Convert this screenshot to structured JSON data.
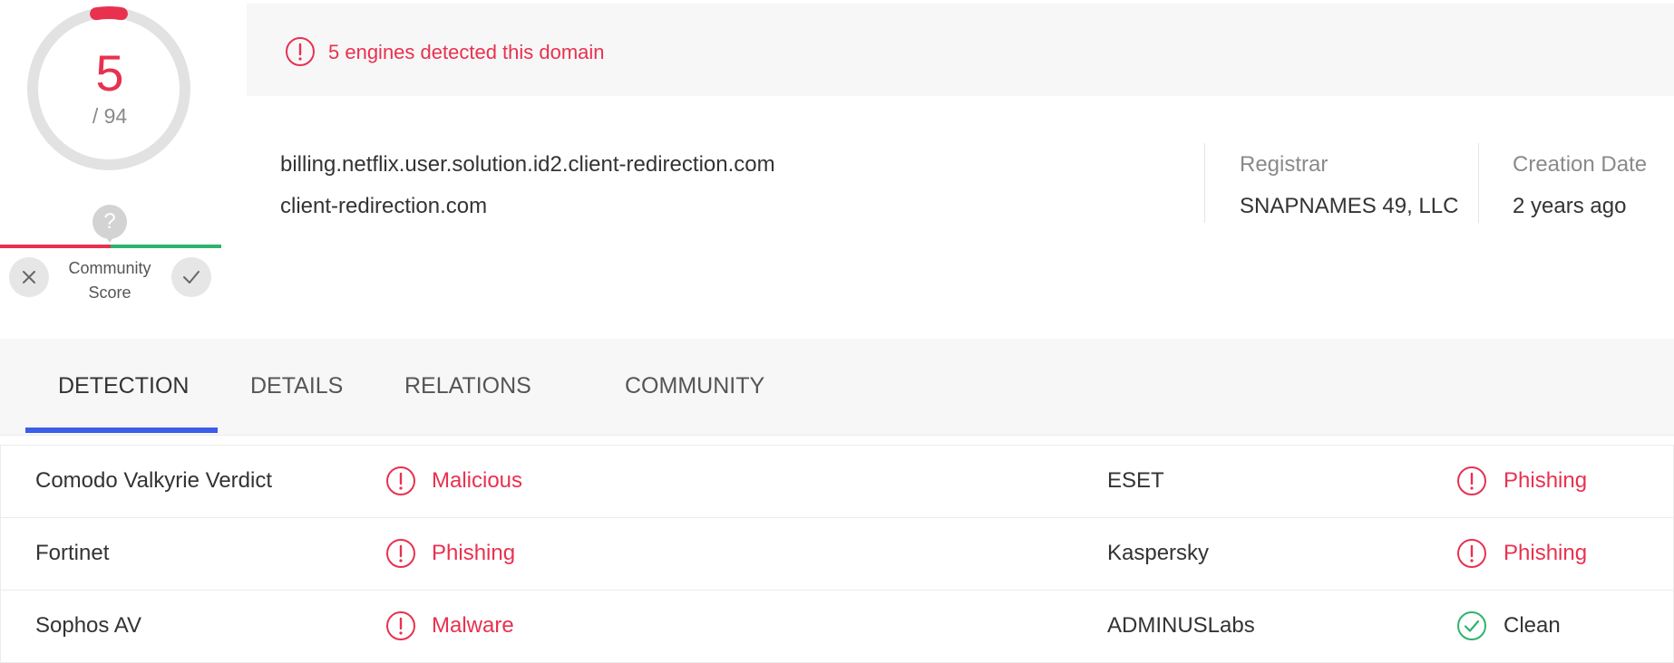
{
  "score": {
    "detected": "5",
    "total": "/ 94",
    "fraction": 0.053,
    "accent_color": "#e8314f"
  },
  "community": {
    "label_line1": "Community",
    "label_line2": "Score",
    "marker": "?",
    "downvote_icon": "x-icon",
    "upvote_icon": "check-icon"
  },
  "banner": {
    "icon": "alert-circle-icon",
    "text": "5 engines detected this domain"
  },
  "domain": {
    "name": "billing.netflix.user.solution.id2.client-redirection.com",
    "parent": "client-redirection.com"
  },
  "meta": {
    "registrar_label": "Registrar",
    "registrar_value": "SNAPNAMES 49, LLC",
    "creation_label": "Creation Date",
    "creation_value": "2 years ago"
  },
  "tabs": [
    {
      "label": "DETECTION",
      "active": true
    },
    {
      "label": "DETAILS",
      "active": false
    },
    {
      "label": "RELATIONS",
      "active": false
    },
    {
      "label": "COMMUNITY",
      "active": false
    }
  ],
  "detections": [
    {
      "left_engine": "Comodo Valkyrie Verdict",
      "left_verdict": "Malicious",
      "right_engine": "ESET",
      "right_verdict": "Phishing"
    },
    {
      "left_engine": "Fortinet",
      "left_verdict": "Phishing",
      "right_engine": "Kaspersky",
      "right_verdict": "Phishing"
    },
    {
      "left_engine": "Sophos AV",
      "left_verdict": "Malware",
      "right_engine": "ADMINUSLabs",
      "right_verdict": "Clean"
    }
  ],
  "colors": {
    "malicious": "#e8314f",
    "clean": "#2eb36d",
    "tab_underline": "#3b5de7"
  }
}
